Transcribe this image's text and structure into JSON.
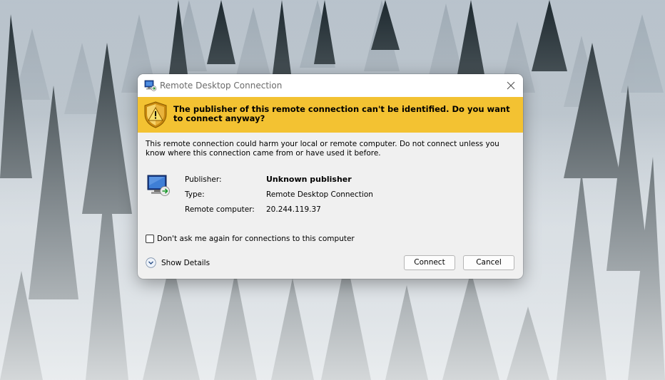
{
  "window": {
    "title": "Remote Desktop Connection"
  },
  "warning": {
    "message": "The publisher of this remote connection can't be identified. Do you want to connect anyway?"
  },
  "body": {
    "description": "This remote connection could harm your local or remote computer. Do not connect unless you know where this connection came from or have used it before."
  },
  "details": {
    "publisher_label": "Publisher:",
    "publisher_value": "Unknown publisher",
    "type_label": "Type:",
    "type_value": "Remote Desktop Connection",
    "computer_label": "Remote computer:",
    "computer_value": "20.244.119.37"
  },
  "options": {
    "dont_ask_label": "Don't ask me again for connections to this computer",
    "dont_ask_checked": false,
    "show_details_label": "Show Details"
  },
  "buttons": {
    "connect": "Connect",
    "cancel": "Cancel"
  },
  "icons": {
    "title": "remote-desktop-icon",
    "close": "close-icon",
    "warning": "shield-warning-icon",
    "computer": "remote-computer-icon",
    "expand": "chevron-down-circle-icon"
  },
  "colors": {
    "warning_banner": "#f3c232",
    "dialog_bg": "#f0f0f0"
  }
}
